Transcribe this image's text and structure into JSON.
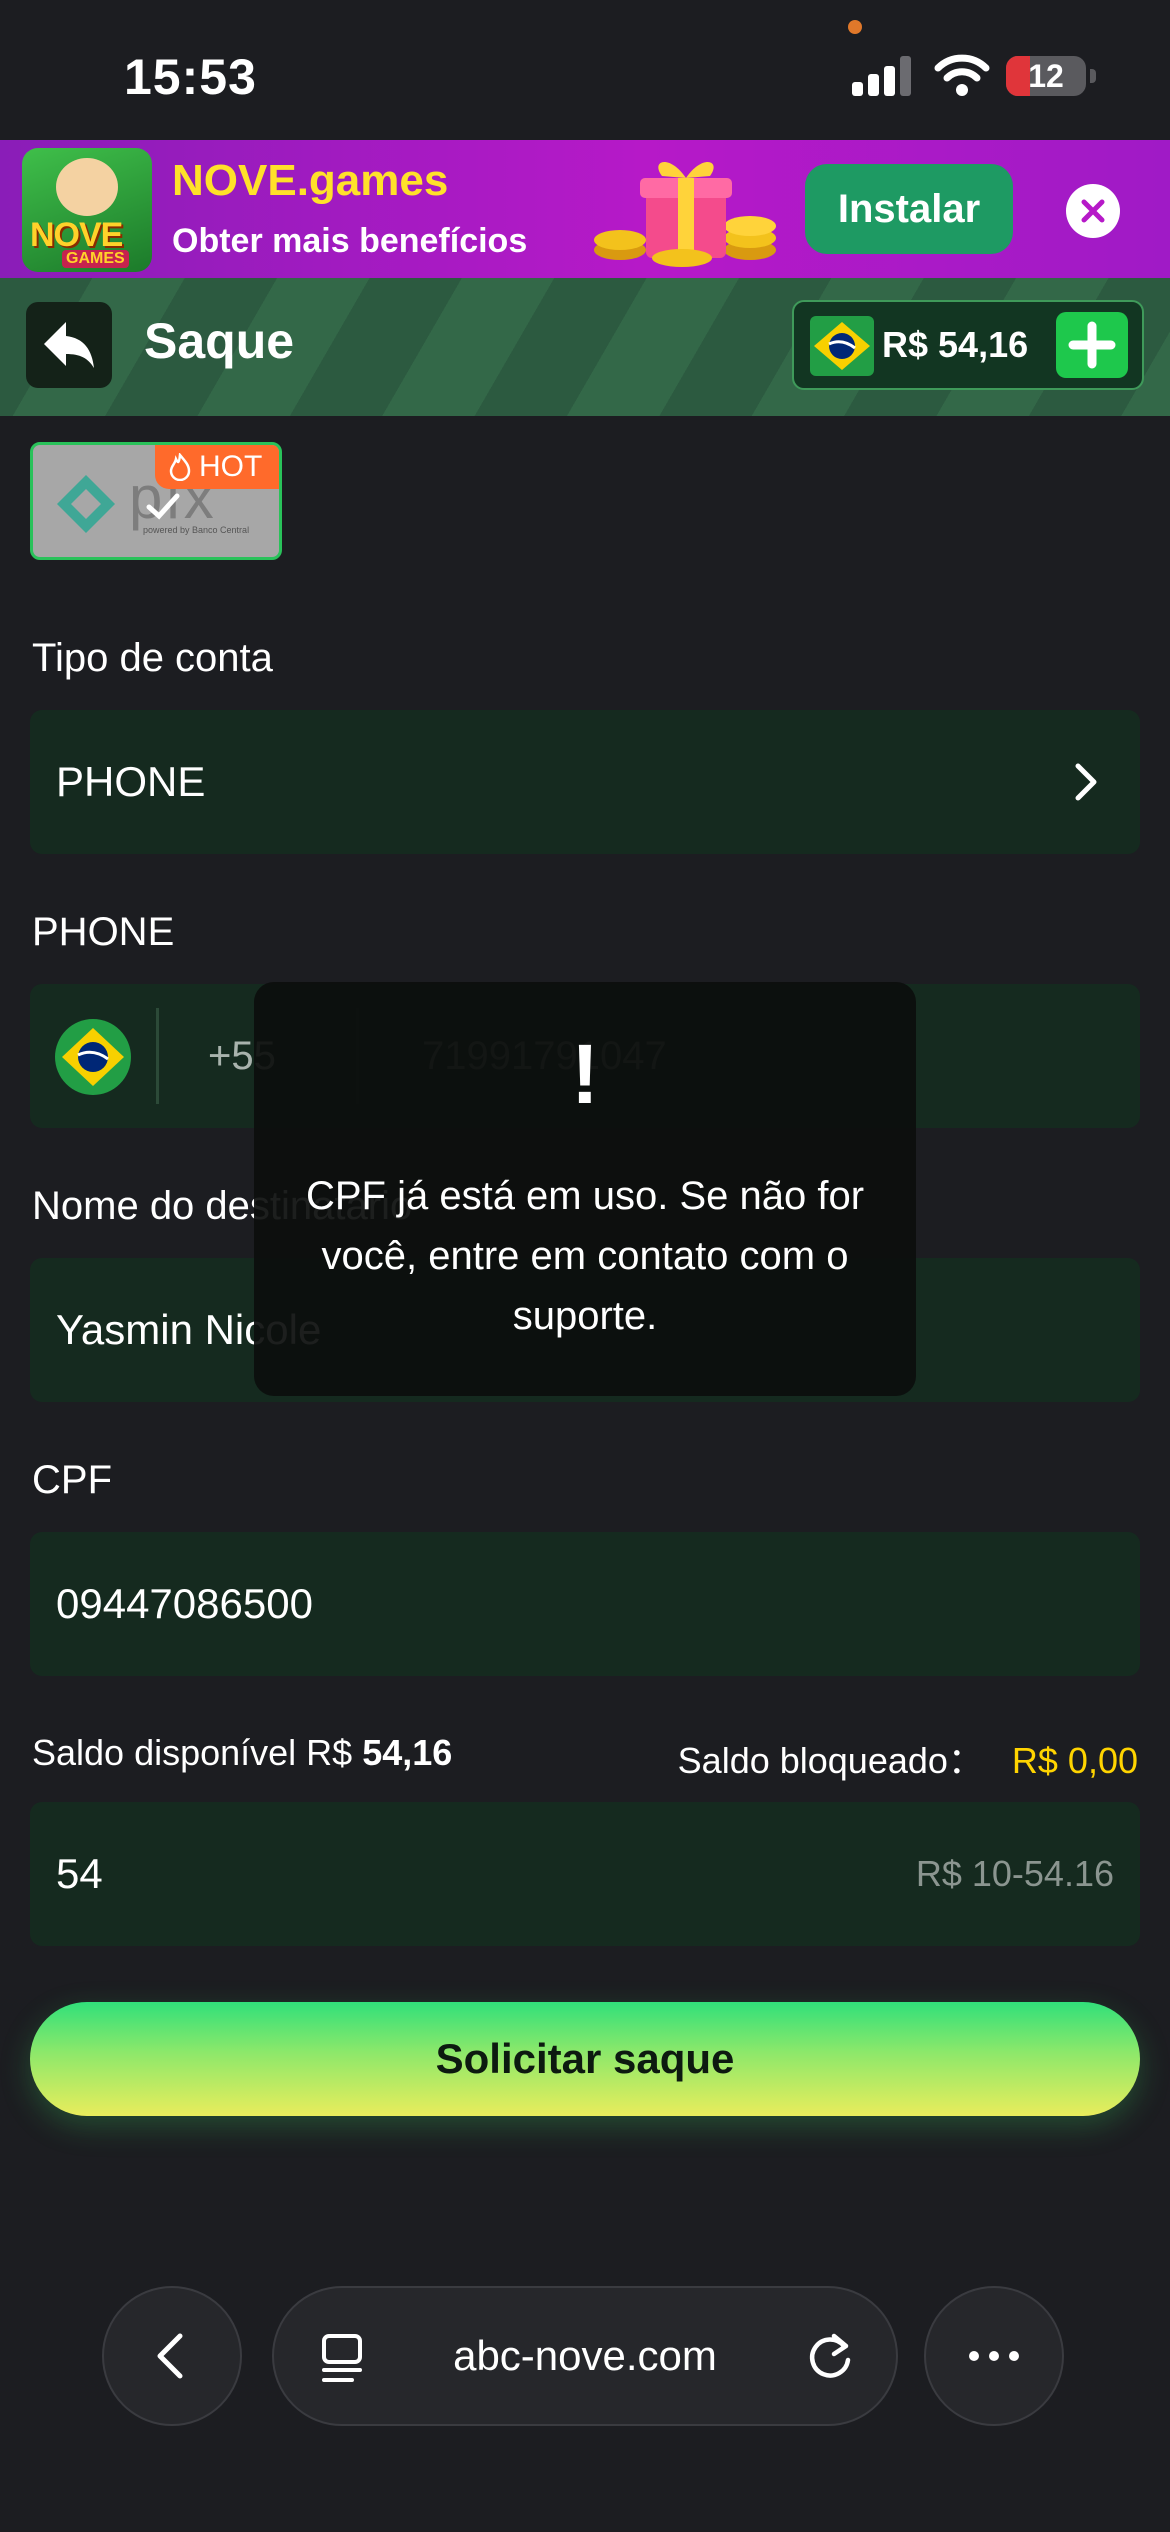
{
  "status_bar": {
    "time": "15:53",
    "battery": "12"
  },
  "banner": {
    "logo_text": "NOVE",
    "logo_sub": "GAMES",
    "title": "NOVE.games",
    "subtitle": "Obter mais benefícios",
    "install_label": "Instalar"
  },
  "header": {
    "title": "Saque",
    "balance": "R$ 54,16"
  },
  "payment_method": {
    "badge": "HOT",
    "logo_text": "pix",
    "logo_caption": "powered by Banco Central"
  },
  "form": {
    "account_type": {
      "label": "Tipo de conta",
      "value": "PHONE"
    },
    "phone": {
      "label": "PHONE",
      "country_code": "+55",
      "number": "71991791047"
    },
    "recipient": {
      "label": "Nome do destinatário",
      "value": "Yasmin Nicole"
    },
    "cpf": {
      "label": "CPF",
      "value": "09447086500"
    },
    "available_balance_label": "Saldo disponível R$",
    "available_balance_value": "54,16",
    "blocked_balance_label": "Saldo bloqueado：",
    "blocked_balance_value": "R$ 0,00",
    "amount": {
      "value": "54",
      "range": "R$ 10-54.16"
    },
    "submit_label": "Solicitar saque"
  },
  "toast": {
    "icon": "!",
    "message": "CPF já está em uso. Se não for você, entre em contato com o suporte."
  },
  "browser": {
    "url": "abc-nove.com"
  },
  "colors": {
    "background": "#1c1d21",
    "field": "#152a1f",
    "accent_green": "#29c25a",
    "accent_yellow": "#ffd400",
    "banner_purple": "#b619c8"
  }
}
